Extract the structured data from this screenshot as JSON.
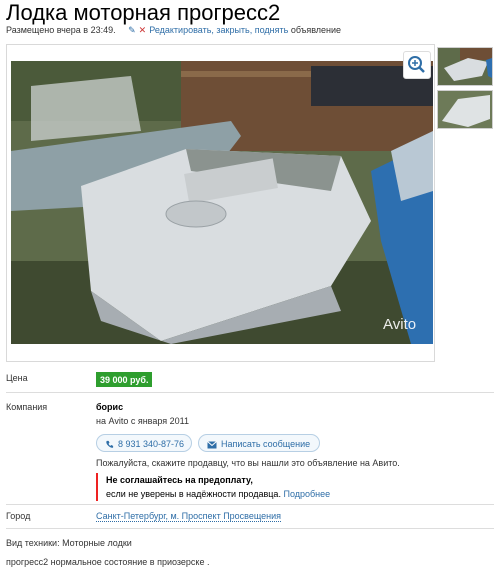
{
  "title": "Лодка моторная прогресс2",
  "meta": {
    "posted": "Размещено вчера в 23:49.",
    "actions_link": "Редактировать, закрыть, поднять",
    "actions_suffix": "объявление"
  },
  "gallery": {
    "watermark": "Avito",
    "zoom_icon": "zoom-in-icon"
  },
  "price": {
    "label": "Цена",
    "value": "39 000 руб."
  },
  "company": {
    "label": "Компания",
    "name": "борис",
    "since": "на Avito с января 2011",
    "phone_button": "8 931 340-87-76",
    "message_button": "Написать сообщение",
    "notice": "Пожалуйста, скажите продавцу, что вы нашли это объявление на Авито.",
    "warning_bold": "Не соглашайтесь на предоплату,",
    "warning_text": "если не уверены в надёжности продавца.",
    "warning_link": "Подробнее"
  },
  "city": {
    "label": "Город",
    "value": "Санкт-Петербург, м. Проспект Просвещения"
  },
  "description": {
    "type_line": "Вид техники: Моторные лодки",
    "text": "прогресс2 нормальное состояние в приозерске ."
  },
  "colors": {
    "link": "#2f6ea7",
    "price_bg": "#2e9e2e",
    "warning_bar": "#e22222"
  }
}
